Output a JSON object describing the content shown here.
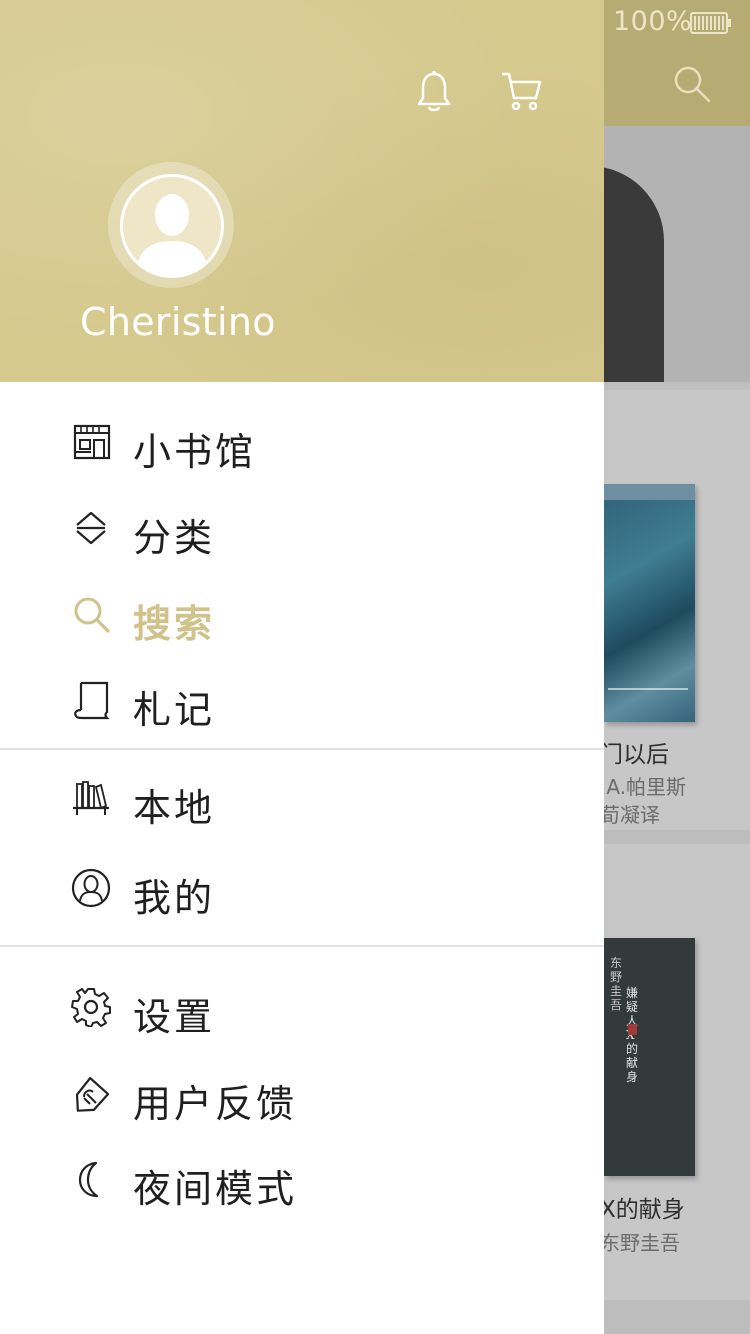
{
  "status_bar": {
    "battery": "100%"
  },
  "background": {
    "books": [
      {
        "title": "门以后",
        "author": ".A.帕里斯",
        "translator": "荀凝译"
      },
      {
        "title": "X的献身",
        "author": "东野圭吾"
      }
    ],
    "cover2_text_a": "东野圭吾",
    "cover2_text_b": "嫌疑人X的献身"
  },
  "drawer": {
    "username": "Cheristino",
    "menu": [
      {
        "label": "小书馆",
        "icon": "bookstore-icon"
      },
      {
        "label": "分类",
        "icon": "category-icon"
      },
      {
        "label": "搜索",
        "icon": "search-icon",
        "active": true
      },
      {
        "label": "札记",
        "icon": "notes-icon"
      },
      {
        "label": "本地",
        "icon": "bookshelf-icon"
      },
      {
        "label": "我的",
        "icon": "user-icon"
      },
      {
        "label": "设置",
        "icon": "settings-icon"
      },
      {
        "label": "用户反馈",
        "icon": "feedback-icon"
      },
      {
        "label": "夜间模式",
        "icon": "moon-icon"
      }
    ]
  },
  "colors": {
    "accent": "#d0c28a",
    "header": "#d6c98e"
  }
}
